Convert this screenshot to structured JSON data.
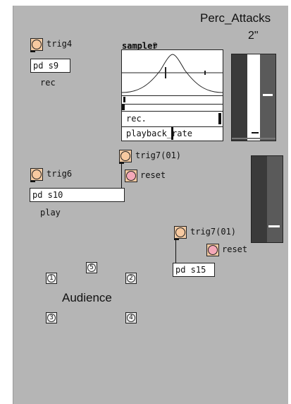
{
  "patch": {
    "title": "Perc_Attacks",
    "duration_label": "2\"",
    "sampler_label_a": "sampler",
    "sampler_label_b": "sample9",
    "sampler_rows": [
      "rec.",
      "playback_rate"
    ]
  },
  "groups": [
    {
      "trigger_label": "trig4",
      "object_label": "pd s9",
      "caption": "rec"
    },
    {
      "trigger_label": "trig6",
      "object_label": "pd s10",
      "caption": "play",
      "secondary_trigger_label": "trig7(01)",
      "reset_label": "reset"
    },
    {
      "trigger_label": "trig7(01)",
      "reset_label": "reset",
      "object_label": "pd s15"
    }
  ],
  "audience": {
    "label": "Audience",
    "numbers": [
      "1",
      "5",
      "2",
      "3",
      "4"
    ]
  },
  "sliders": {
    "top_levels": [
      0.25,
      0.55
    ],
    "bottom_levels": [
      0.25,
      0.2
    ]
  },
  "colors": {
    "canvas_bg": "#b5b5b5",
    "bang_fill": "#f7c9a0",
    "reset_fill": "#f4a8b8",
    "slider_dark": "#3a3a3a",
    "slider_mid": "#5a5a5a",
    "slider_light": "#ffffff"
  },
  "icons": [
    "bang-icon",
    "reset-bang-icon",
    "number-circle-icon"
  ]
}
